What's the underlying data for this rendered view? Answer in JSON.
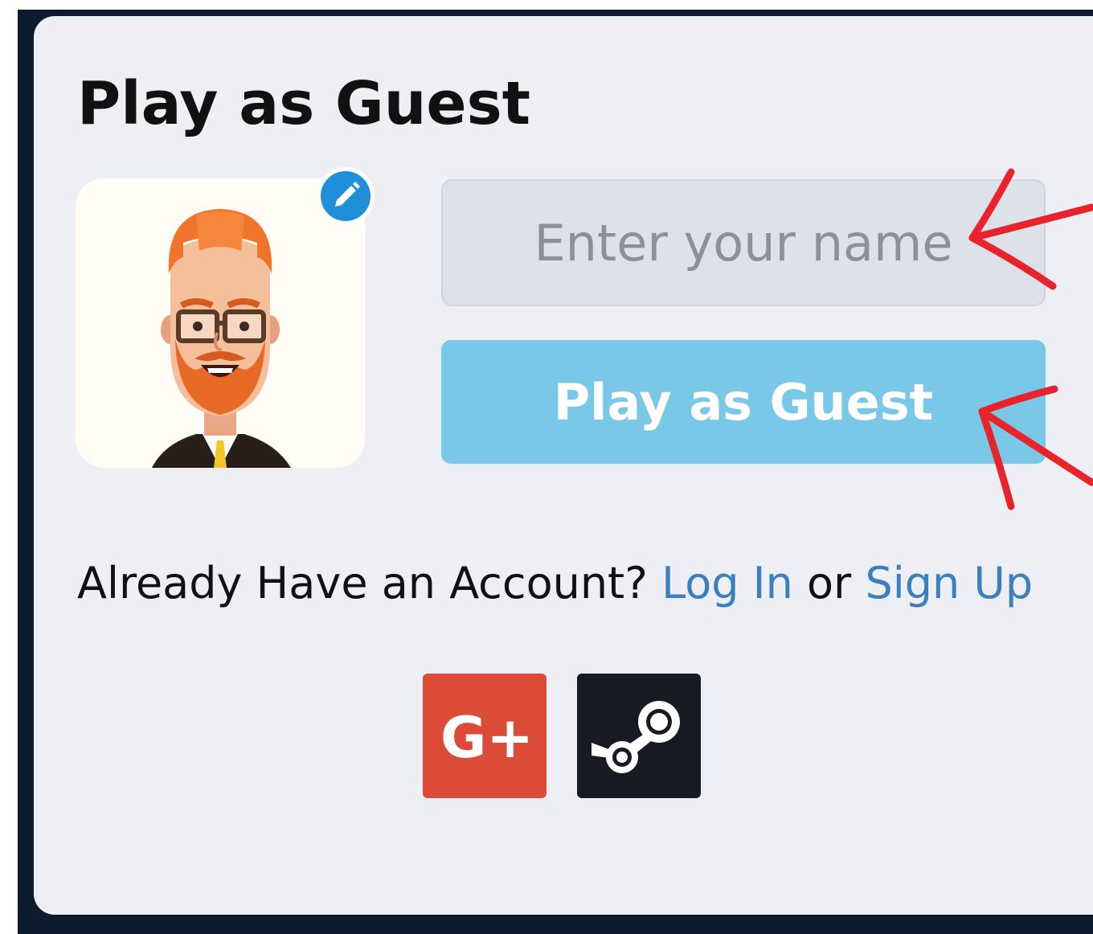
{
  "panel": {
    "title": "Play as Guest"
  },
  "avatar": {
    "icon": "cartoon-man-avatar",
    "edit_icon": "pencil-icon"
  },
  "name_input": {
    "placeholder": "Enter your name",
    "value": ""
  },
  "play_button": {
    "label": "Play as Guest"
  },
  "account": {
    "prompt": "Already Have an Account?",
    "login_label": "Log In",
    "connector": "or",
    "signup_label": "Sign Up"
  },
  "social": {
    "google_label": "G+",
    "google_color": "#dc4a38",
    "steam_icon": "steam-icon",
    "steam_color": "#171a21"
  },
  "colors": {
    "accent": "#1e8fd8",
    "button": "#79c8e8",
    "link": "#3b7fc0",
    "annotation": "#e8232b"
  }
}
